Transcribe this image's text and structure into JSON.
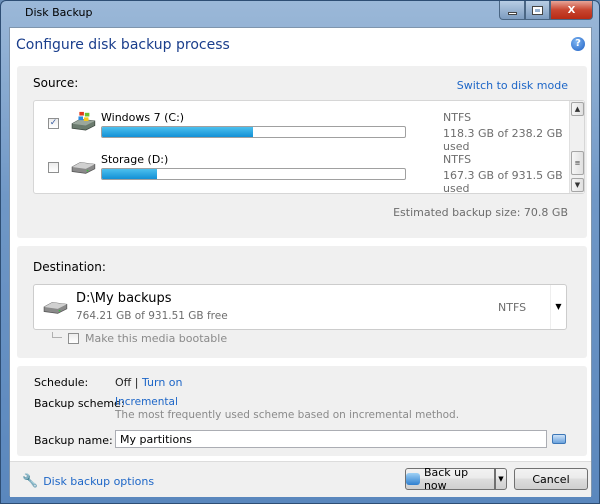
{
  "window": {
    "title": "Disk Backup",
    "controls": {
      "minimize": "—",
      "maximize": "▫",
      "close": "X"
    }
  },
  "header": {
    "title": "Configure disk backup process",
    "help_icon": "?"
  },
  "source": {
    "label": "Source:",
    "switch_link": "Switch to disk mode",
    "disks": [
      {
        "name": "Windows 7 (C:)",
        "checked": true,
        "filesystem": "NTFS",
        "usage": "118.3 GB of 238.2 GB used",
        "used_fraction": 0.497,
        "icon": "windows-drive-icon"
      },
      {
        "name": "Storage (D:)",
        "checked": false,
        "filesystem": "NTFS",
        "usage": "167.3 GB of 931.5 GB used",
        "used_fraction": 0.18,
        "icon": "hard-drive-icon"
      }
    ],
    "estimated_size": "Estimated backup size: 70.8 GB"
  },
  "destination": {
    "label": "Destination:",
    "path": "D:\\My backups",
    "free": "764.21 GB of 931.51 GB free",
    "filesystem": "NTFS",
    "bootable_label": "Make this media bootable",
    "bootable_checked": false
  },
  "settings": {
    "schedule_label": "Schedule:",
    "schedule_value": "Off",
    "schedule_sep": "|",
    "schedule_link": "Turn on",
    "scheme_label": "Backup scheme:",
    "scheme_link": "Incremental",
    "scheme_desc": "The most frequently used scheme based on incremental method.",
    "name_label": "Backup name:",
    "name_value": "My partitions"
  },
  "footer": {
    "options_link": "Disk backup options",
    "backup_now": "Back up now",
    "cancel": "Cancel"
  },
  "colors": {
    "accent": "#1d66c7",
    "title": "#1a3e8c",
    "progress": "#1390d5"
  }
}
